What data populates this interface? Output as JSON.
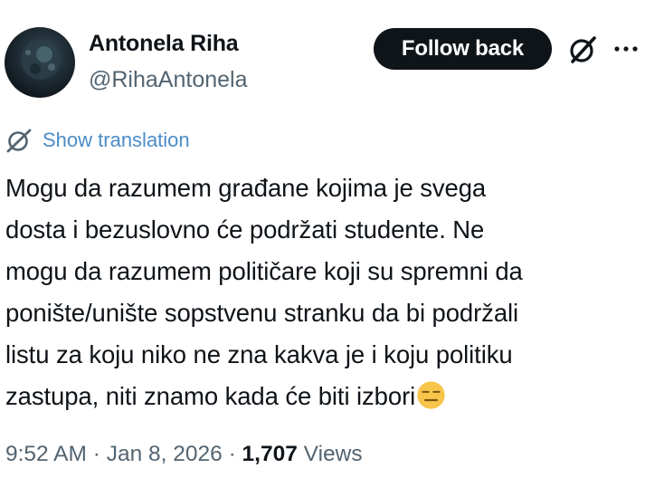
{
  "author": {
    "display_name": "Antonela Riha",
    "handle": "@RihaAntonela",
    "avatar_icon": "avatar"
  },
  "actions": {
    "follow_label": "Follow back",
    "grok_icon": "grok-icon",
    "more_icon": "more-icon"
  },
  "translation": {
    "icon": "translate-icon",
    "label": "Show translation",
    "color": "#4a8cc7"
  },
  "post": {
    "lines": [
      "Mogu da razumem građane kojima je svega",
      "dosta i bezuslovno će podržati studente. Ne",
      "mogu da razumem političare koji su spremni da",
      "ponište/unište sopstvenu stranku da bi podržali",
      "listu za koju niko ne zna kakva je i koju politiku",
      "zastupa, niti znamo kada će biti izbori"
    ],
    "trailing_emoji": "expressionless-face"
  },
  "meta": {
    "time": "9:52 AM",
    "separator": "·",
    "date": "Jan 8, 2026",
    "views_count": "1,707",
    "views_label": "Views"
  },
  "colors": {
    "text": "#0f1419",
    "secondary": "#536471",
    "button_bg": "#0f1419",
    "button_text": "#ffffff"
  }
}
